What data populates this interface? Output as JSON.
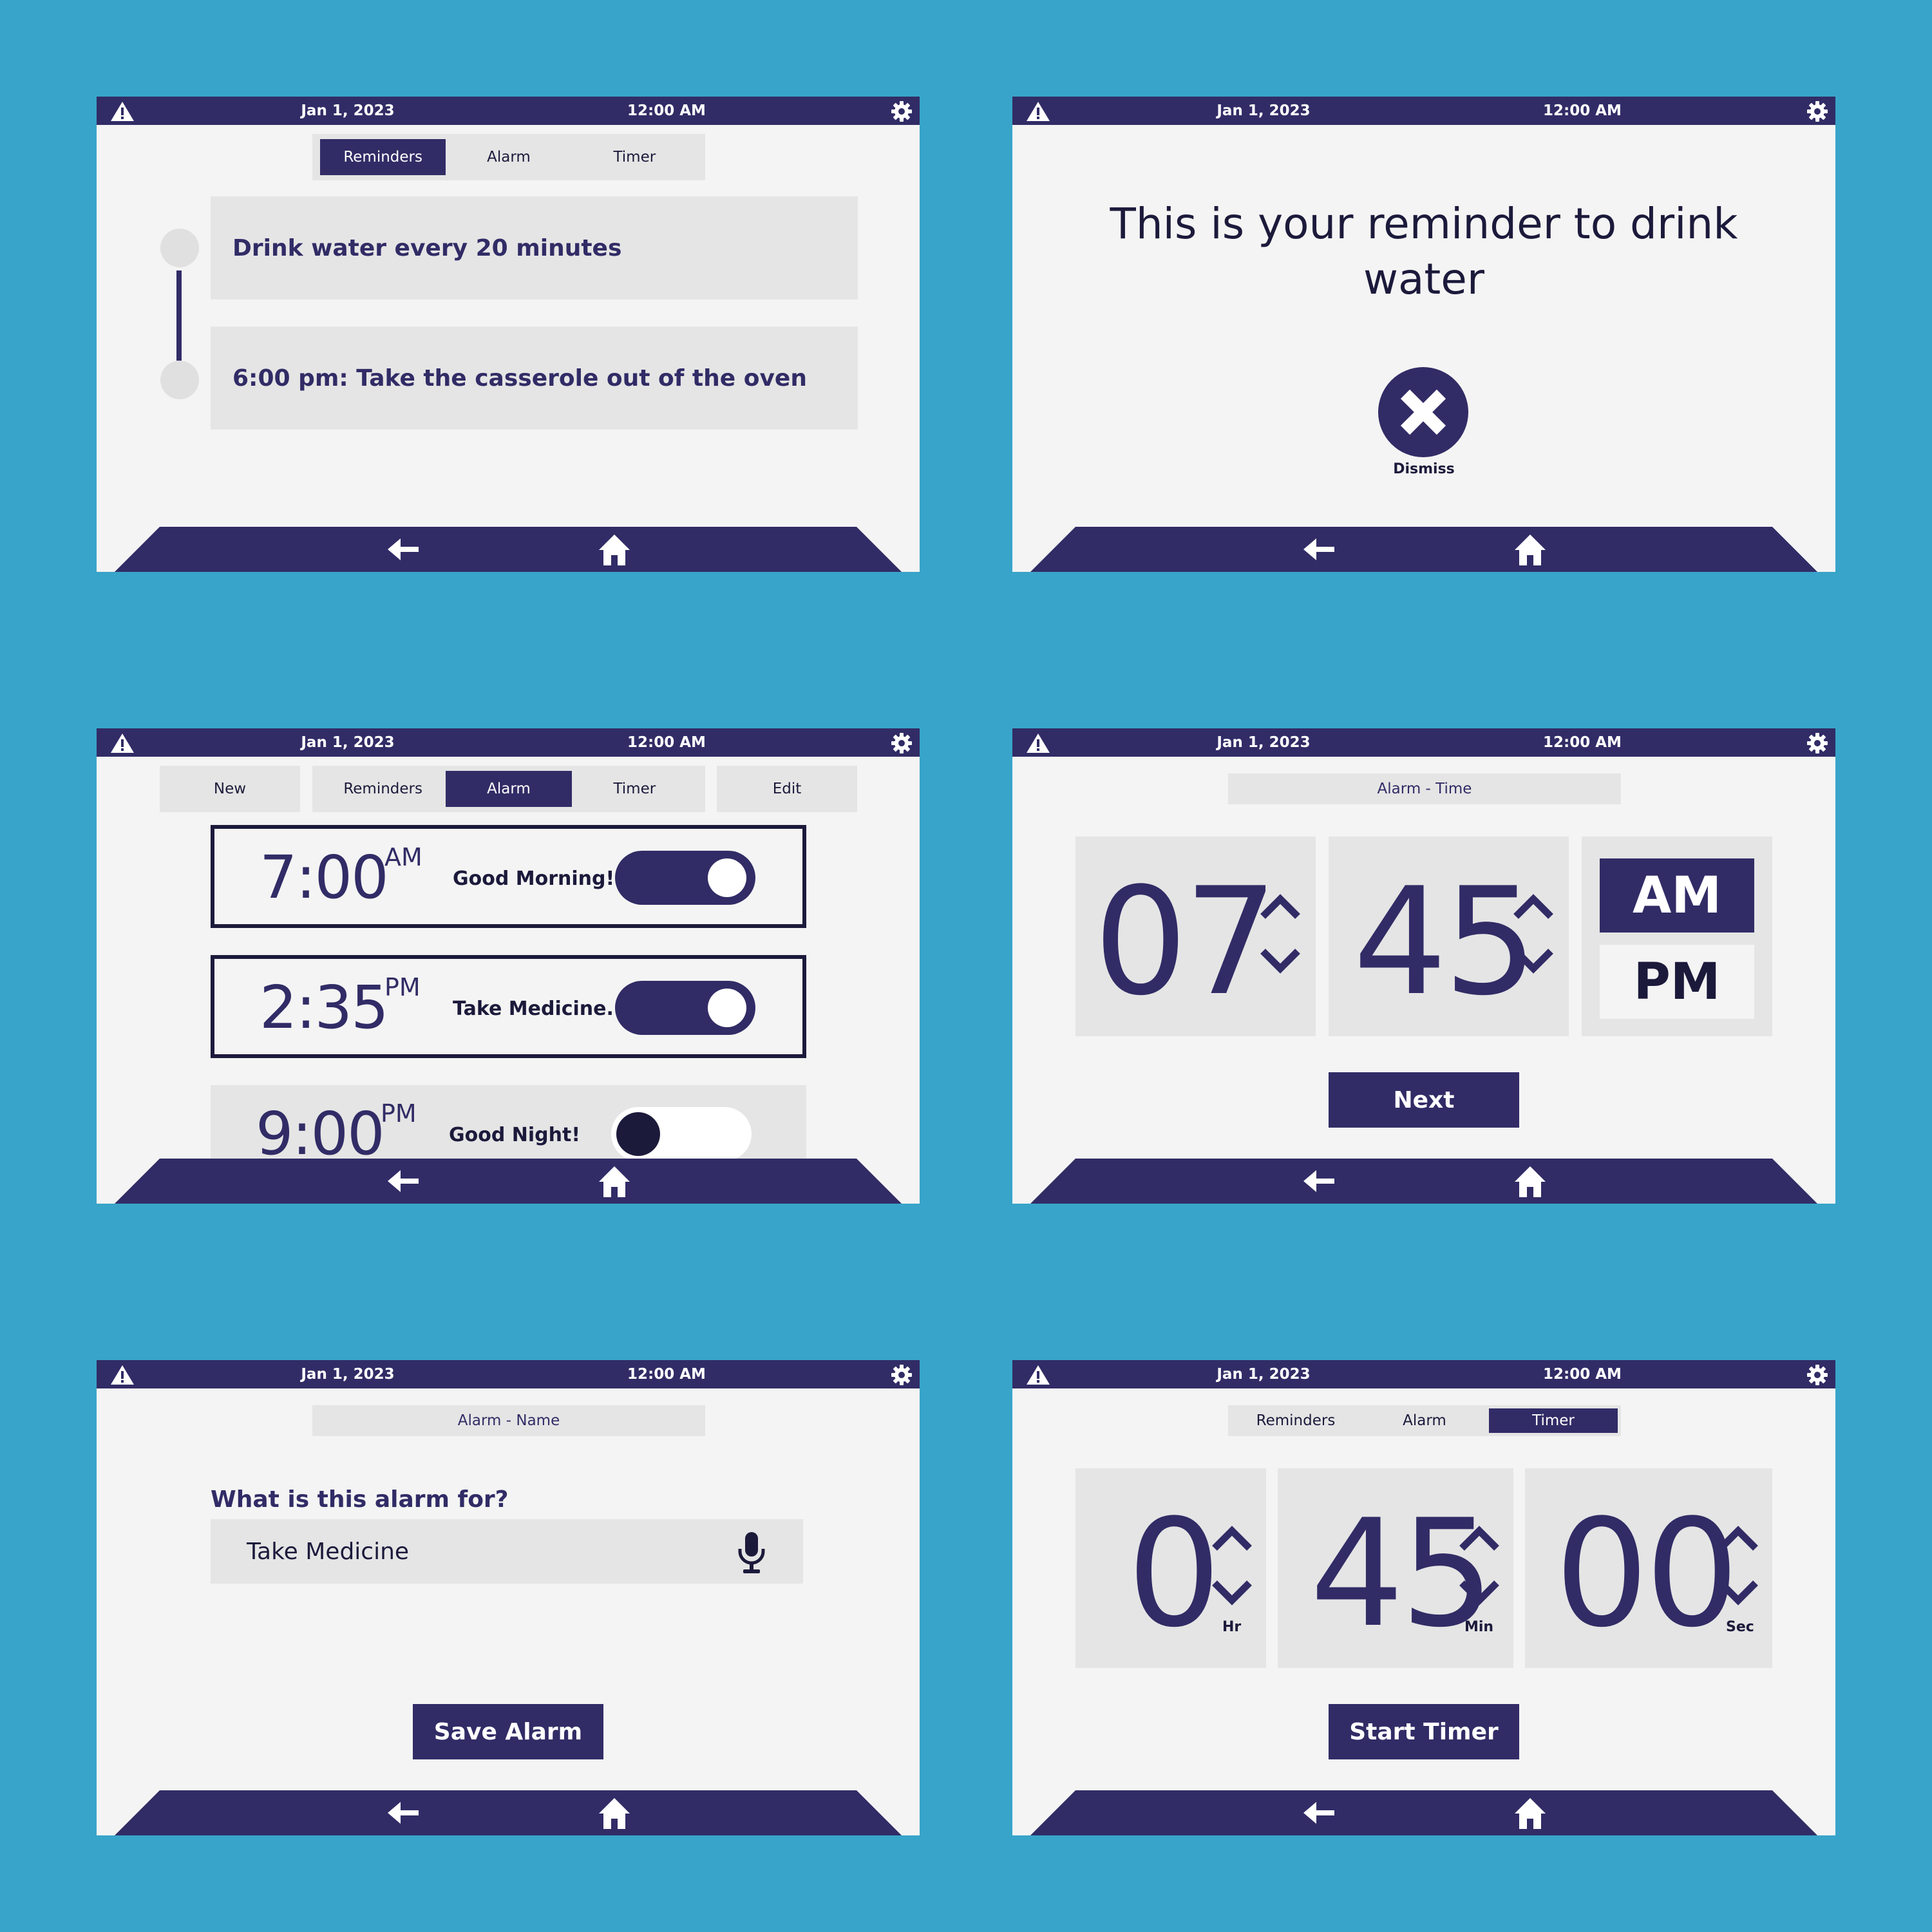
{
  "status": {
    "date": "Jan 1, 2023",
    "time": "12:00 AM"
  },
  "icons": {
    "warning": "warning-icon",
    "settings": "gear-icon",
    "back": "back-arrow-icon",
    "home": "home-icon",
    "dismiss": "close-icon",
    "mic": "microphone-icon"
  },
  "colors": {
    "background": "#38a4c9",
    "primary": "#312c66",
    "surface": "#f4f4f4",
    "panel": "#e5e5e5"
  },
  "tabs": {
    "reminders": "Reminders",
    "alarm": "Alarm",
    "timer": "Timer",
    "new": "New",
    "edit": "Edit"
  },
  "reminders": {
    "items": [
      {
        "text": "Drink water every 20 minutes"
      },
      {
        "text": "6:00 pm: Take the casserole out of the oven"
      }
    ]
  },
  "notification": {
    "message": "This is your reminder to drink water",
    "dismiss_label": "Dismiss"
  },
  "alarms": {
    "items": [
      {
        "time": "7:00",
        "period": "AM",
        "label": "Good Morning!",
        "enabled": true
      },
      {
        "time": "2:35",
        "period": "PM",
        "label": "Take Medicine.",
        "enabled": true
      },
      {
        "time": "9:00",
        "period": "PM",
        "label": "Good Night!",
        "enabled": false
      }
    ]
  },
  "alarm_time": {
    "title": "Alarm - Time",
    "hour": "07",
    "minute": "45",
    "am": "AM",
    "pm": "PM",
    "selected": "AM",
    "next_label": "Next"
  },
  "alarm_name": {
    "title": "Alarm - Name",
    "question": "What is this alarm for?",
    "value": "Take Medicine",
    "save_label": "Save Alarm"
  },
  "timer": {
    "hours": "0",
    "minutes": "45",
    "seconds": "00",
    "hr_label": "Hr",
    "min_label": "Min",
    "sec_label": "Sec",
    "start_label": "Start Timer"
  }
}
